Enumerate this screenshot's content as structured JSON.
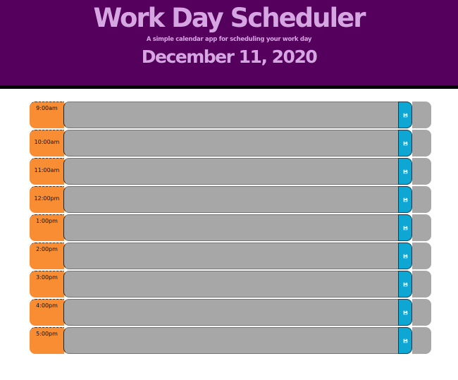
{
  "header": {
    "title": "Work Day Scheduler",
    "subtitle": "A simple calendar app for scheduling your work day",
    "current_date": "December 11, 2020"
  },
  "timeblocks": [
    {
      "hour": "9:00am",
      "text": ""
    },
    {
      "hour": "10:00am",
      "text": ""
    },
    {
      "hour": "11:00am",
      "text": ""
    },
    {
      "hour": "12:00pm",
      "text": ""
    },
    {
      "hour": "1:00pm",
      "text": ""
    },
    {
      "hour": "2:00pm",
      "text": ""
    },
    {
      "hour": "3:00pm",
      "text": ""
    },
    {
      "hour": "4:00pm",
      "text": ""
    },
    {
      "hour": "5:00pm",
      "text": ""
    }
  ],
  "colors": {
    "header_bg": "#55005c",
    "header_text": "#d6a6e3",
    "hour_bg": "#f98d33",
    "row_bg": "#a7a7a7",
    "save_bg": "#0ea6d3"
  },
  "icons": {
    "save": "floppy-disk-icon"
  }
}
